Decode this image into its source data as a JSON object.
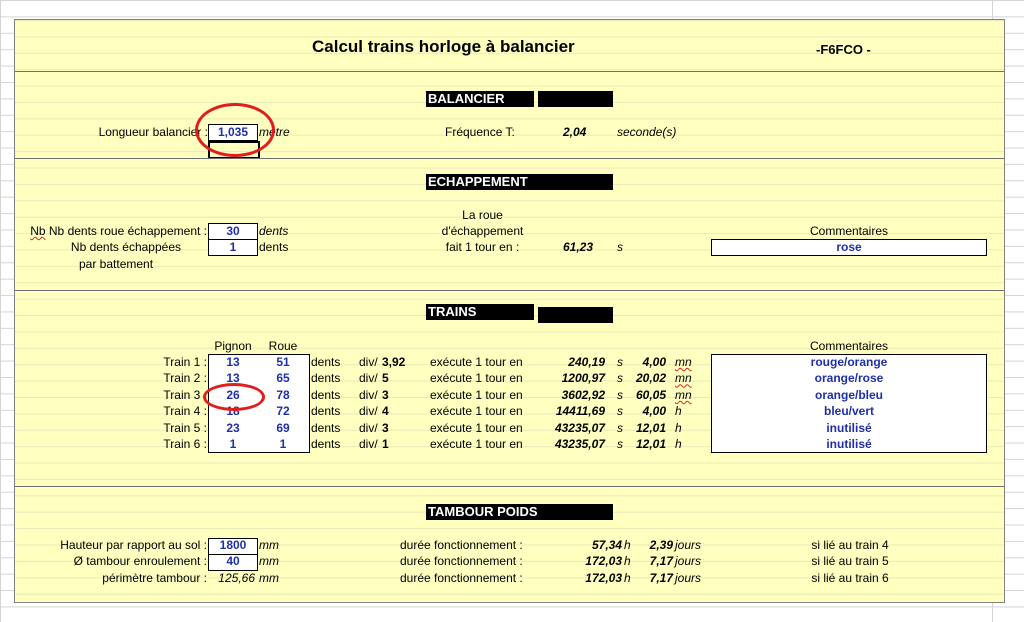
{
  "title": "Calcul trains horloge à balancier",
  "author": "-F6FCO -",
  "balancier": {
    "header": "BALANCIER",
    "longueur_label": "Longueur balancier :",
    "longueur_value": "1,035",
    "longueur_unit": "mètre",
    "frequence_label": "Fréquence T:",
    "frequence_value": "2,04",
    "frequence_unit": "seconde(s)"
  },
  "echappement": {
    "header": "ECHAPPEMENT",
    "nb_dents_label": "Nb dents roue échappement :",
    "nb_dents_value": "30",
    "nb_dents_unit": "dents",
    "echappees_label_1": "Nb dents échappées",
    "echappees_label_2": "par battement",
    "echappees_value": "1",
    "echappees_unit": "dents",
    "roue_label_1": "La roue",
    "roue_label_2": "d'échappement",
    "roue_label_3": "fait 1 tour en :",
    "tour_value": "61,23",
    "tour_unit": "s",
    "comment_header": "Commentaires",
    "comment_value": "rose"
  },
  "trains": {
    "header": "TRAINS",
    "col_pignon": "Pignon",
    "col_roue": "Roue",
    "comment_header": "Commentaires",
    "rows": [
      {
        "label": "Train 1 :",
        "pignon": "13",
        "roue": "51",
        "dents": "dents",
        "div": "div/",
        "div_value": "3,92",
        "exec": "exécute 1 tour en",
        "time": "240,19",
        "s": "s",
        "time2": "4,00",
        "unit2": "mn",
        "comment": "rouge/orange"
      },
      {
        "label": "Train 2 :",
        "pignon": "13",
        "roue": "65",
        "dents": "dents",
        "div": "div/",
        "div_value": "5",
        "exec": "exécute 1 tour en",
        "time": "1200,97",
        "s": "s",
        "time2": "20,02",
        "unit2": "mn",
        "comment": "orange/rose"
      },
      {
        "label": "Train 3 :",
        "pignon": "26",
        "roue": "78",
        "dents": "dents",
        "div": "div/",
        "div_value": "3",
        "exec": "exécute 1 tour en",
        "time": "3602,92",
        "s": "s",
        "time2": "60,05",
        "unit2": "mn",
        "comment": "orange/bleu"
      },
      {
        "label": "Train 4 :",
        "pignon": "18",
        "roue": "72",
        "dents": "dents",
        "div": "div/",
        "div_value": "4",
        "exec": "exécute 1 tour en",
        "time": "14411,69",
        "s": "s",
        "time2": "4,00",
        "unit2": "h",
        "comment": "bleu/vert"
      },
      {
        "label": "Train 5 :",
        "pignon": "23",
        "roue": "69",
        "dents": "dents",
        "div": "div/",
        "div_value": "3",
        "exec": "exécute 1 tour en",
        "time": "43235,07",
        "s": "s",
        "time2": "12,01",
        "unit2": "h",
        "comment": "inutilisé"
      },
      {
        "label": "Train 6 :",
        "pignon": "1",
        "roue": "1",
        "dents": "dents",
        "div": "div/",
        "div_value": "1",
        "exec": "exécute 1 tour en",
        "time": "43235,07",
        "s": "s",
        "time2": "12,01",
        "unit2": "h",
        "comment": "inutilisé"
      }
    ]
  },
  "tambour": {
    "header": "TAMBOUR  POIDS",
    "rows": [
      {
        "label": "Hauteur par rapport au sol :",
        "value": "1800",
        "unit": "mm",
        "duree": "durée fonctionnement :",
        "hours": "57,34",
        "h": "h",
        "days": "2,39",
        "jours": "jours",
        "note": "si lié au train 4"
      },
      {
        "label": "Ø tambour enroulement :",
        "value": "40",
        "unit": "mm",
        "duree": "durée fonctionnement :",
        "hours": "172,03",
        "h": "h",
        "days": "7,17",
        "jours": "jours",
        "note": "si lié au train 5"
      },
      {
        "label": "périmètre tambour :",
        "value": "125,66",
        "unit": "mm",
        "duree": "durée fonctionnement :",
        "hours": "172,03",
        "h": "h",
        "days": "7,17",
        "jours": "jours",
        "note": "si lié au train 6"
      }
    ]
  },
  "colors": {
    "sheet": "#ffffc0",
    "value_blue": "#1f2fa8",
    "annotation_red": "#e11d1d"
  }
}
